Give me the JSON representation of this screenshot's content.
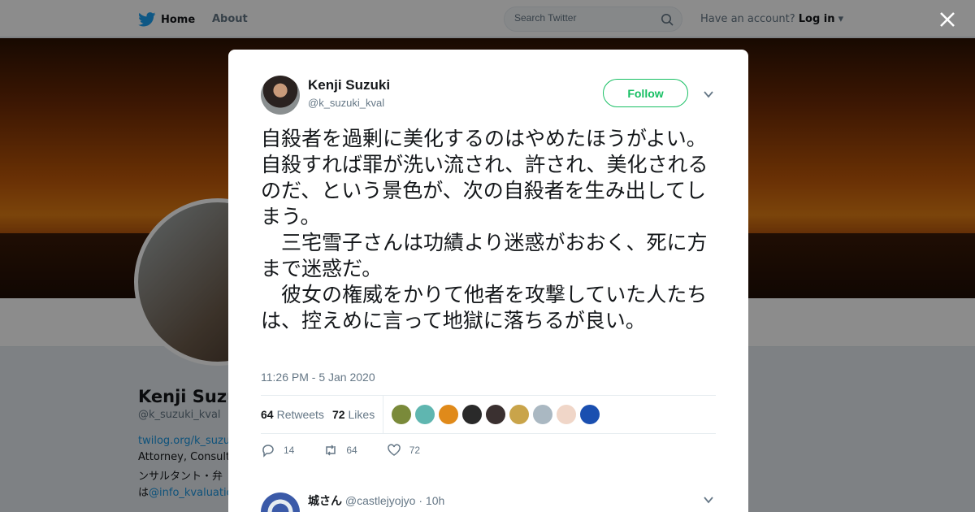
{
  "topbar": {
    "home_label": "Home",
    "about_label": "About",
    "search_placeholder": "Search Twitter",
    "have_account": "Have an account?",
    "login_label": "Log in"
  },
  "profile": {
    "name": "Kenji Suzuki",
    "handle": "@k_suzuki_kval",
    "link": "twilog.org/k_suzu",
    "bio_line1": "Attorney, Consulti",
    "bio_line2": "ンサルタント・弁",
    "bio_line3_prefix": "は",
    "bio_line3_link": "@info_kvaluatio"
  },
  "tweet": {
    "author_name": "Kenji Suzuki",
    "author_handle": "@k_suzuki_kval",
    "follow_label": "Follow",
    "text": "自殺者を過剰に美化するのはやめたほうがよい。自殺すれば罪が洗い流され、許され、美化されるのだ、という景色が、次の自殺者を生み出してしまう。\n　三宅雪子さんは功績より迷惑がおおく、死に方まで迷惑だ。\n　彼女の権威をかりて他者を攻撃していた人たちは、控えめに言って地獄に落ちるが良い。",
    "timestamp": "11:26 PM - 5 Jan 2020",
    "retweets_count": "64",
    "retweets_label": "Retweets",
    "likes_count": "72",
    "likes_label": "Likes",
    "reply_count": "14",
    "retweet_action_count": "64",
    "like_action_count": "72",
    "liker_colors": [
      "#7a8a3a",
      "#5fb6b0",
      "#e08a1a",
      "#2a2a2a",
      "#3a3030",
      "#c9a44a",
      "#aab8c2",
      "#f0d6c8",
      "#1a4fb0"
    ]
  },
  "reply": {
    "name": "城さん",
    "handle": "@castlejyojyo",
    "separator": "·",
    "time": "10h"
  },
  "colors": {
    "accent": "#1da1f2",
    "follow": "#17bf63",
    "muted": "#657786"
  }
}
